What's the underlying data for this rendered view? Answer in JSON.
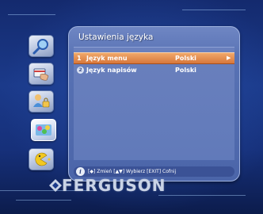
{
  "panel": {
    "title": "Ustawienia języka"
  },
  "menu": {
    "items": [
      {
        "number": "1",
        "label": "Język menu",
        "value": "Polski",
        "arrow": "▶"
      },
      {
        "number": "2",
        "label": "Język napisów",
        "value": "Polski"
      }
    ]
  },
  "help": {
    "info": "i",
    "text": "[◆] Zmień [▲▼] Wybierz [EXIT] Cofnij"
  },
  "brand": {
    "logo": "FERGUSON"
  },
  "sidebar": {
    "icons": [
      "search-icon",
      "hand-card-icon",
      "user-lock-icon",
      "colors-icon",
      "pacman-icon"
    ]
  },
  "colors": {
    "selection": "#d8773b",
    "panel": "#5872b4",
    "background": "#1b3a8a"
  }
}
